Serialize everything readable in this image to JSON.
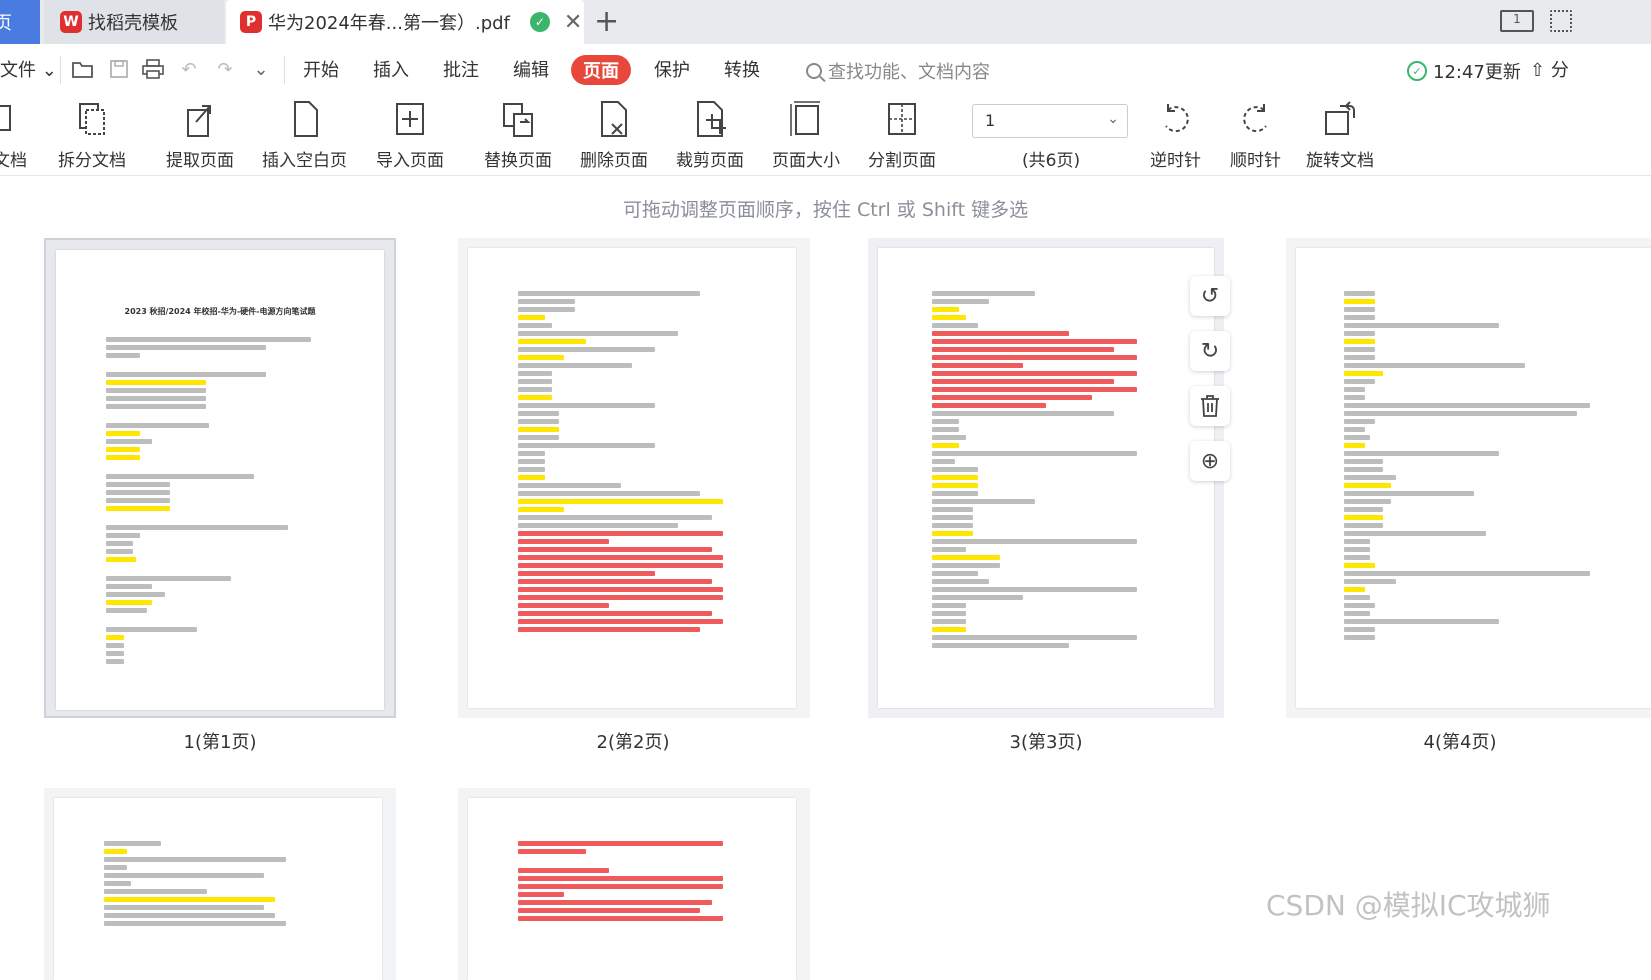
{
  "tabs": {
    "home_label": "页",
    "template_label": "找稻壳模板",
    "pdf_label": "华为2024年春...第一套）.pdf",
    "app_logo": "P"
  },
  "menu": {
    "file": "文件",
    "items": [
      "开始",
      "插入",
      "批注",
      "编辑",
      "页面",
      "保护",
      "转换"
    ],
    "active": "页面",
    "search_placeholder": "查找功能、文档内容",
    "sync_text": "12:47更新",
    "share": "分"
  },
  "ribbon": {
    "merge": "文档",
    "split": "拆分文档",
    "extract": "提取页面",
    "insert_blank": "插入空白页",
    "import": "导入页面",
    "replace": "替换页面",
    "delete": "删除页面",
    "crop": "裁剪页面",
    "size": "页面大小",
    "divide": "分割页面",
    "page_value": "1",
    "page_total": "(共6页)",
    "ccw": "逆时针",
    "cw": "顺时针",
    "rotate": "旋转文档"
  },
  "hint": "可拖动调整页面顺序，按住 Ctrl 或 Shift 键多选",
  "thumbnails": [
    {
      "label": "1(第1页)",
      "title": "2023 秋招/2024 年校招-华为-硬件-电源方向笔试题"
    },
    {
      "label": "2(第2页)"
    },
    {
      "label": "3(第3页)"
    },
    {
      "label": "4(第4页)"
    }
  ],
  "watermark": "CSDN @模拟IC攻城狮",
  "colors": {
    "accent": "#e8483b",
    "tab_home": "#4a7be0",
    "highlight": "#ffe600",
    "answer_red": "#ef5a5a"
  }
}
